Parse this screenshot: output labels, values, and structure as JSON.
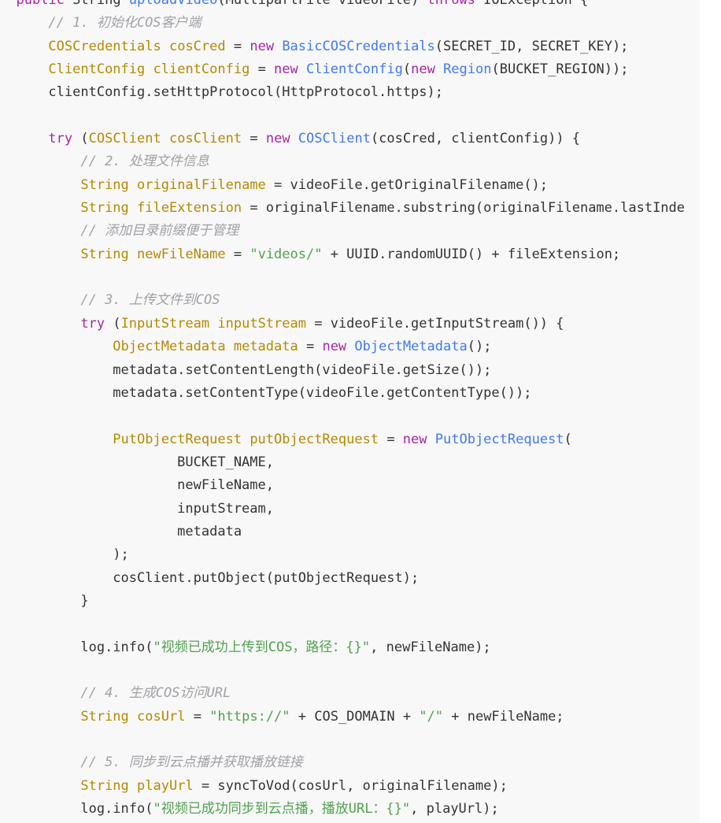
{
  "colors": {
    "background": "#f8f8f8",
    "plain": "#333333",
    "keyword": "#a626a4",
    "type": "#b58900",
    "variable": "#b58900",
    "function": "#4078f2",
    "string": "#50a14f",
    "comment": "#a0a1a7"
  },
  "code": {
    "language": "java",
    "lines": [
      {
        "indent": "  ",
        "tokens": [
          [
            "keyword",
            "public"
          ],
          [
            "plain",
            " String "
          ],
          [
            "func",
            "uploadVideo"
          ],
          [
            "plain",
            "(MultipartFile videoFile) "
          ],
          [
            "keyword",
            "throws"
          ],
          [
            "plain",
            " IOException {"
          ]
        ]
      },
      {
        "indent": "      ",
        "tokens": [
          [
            "comment",
            "// 1. 初始化COS客户端"
          ]
        ]
      },
      {
        "indent": "      ",
        "tokens": [
          [
            "type",
            "COSCredentials"
          ],
          [
            "plain",
            " "
          ],
          [
            "var",
            "cosCred"
          ],
          [
            "plain",
            " = "
          ],
          [
            "keyword",
            "new"
          ],
          [
            "plain",
            " "
          ],
          [
            "func",
            "BasicCOSCredentials"
          ],
          [
            "plain",
            "(SECRET_ID, SECRET_KEY);"
          ]
        ]
      },
      {
        "indent": "      ",
        "tokens": [
          [
            "type",
            "ClientConfig"
          ],
          [
            "plain",
            " "
          ],
          [
            "var",
            "clientConfig"
          ],
          [
            "plain",
            " = "
          ],
          [
            "keyword",
            "new"
          ],
          [
            "plain",
            " "
          ],
          [
            "func",
            "ClientConfig"
          ],
          [
            "plain",
            "("
          ],
          [
            "keyword",
            "new"
          ],
          [
            "plain",
            " "
          ],
          [
            "func",
            "Region"
          ],
          [
            "plain",
            "(BUCKET_REGION));"
          ]
        ]
      },
      {
        "indent": "      ",
        "tokens": [
          [
            "plain",
            "clientConfig.setHttpProtocol(HttpProtocol.https);"
          ]
        ]
      },
      {
        "indent": "",
        "tokens": []
      },
      {
        "indent": "      ",
        "tokens": [
          [
            "keyword",
            "try"
          ],
          [
            "plain",
            " ("
          ],
          [
            "type",
            "COSClient"
          ],
          [
            "plain",
            " "
          ],
          [
            "var",
            "cosClient"
          ],
          [
            "plain",
            " = "
          ],
          [
            "keyword",
            "new"
          ],
          [
            "plain",
            " "
          ],
          [
            "func",
            "COSClient"
          ],
          [
            "plain",
            "(cosCred, clientConfig)) {"
          ]
        ]
      },
      {
        "indent": "          ",
        "tokens": [
          [
            "comment",
            "// 2. 处理文件信息"
          ]
        ]
      },
      {
        "indent": "          ",
        "tokens": [
          [
            "type",
            "String"
          ],
          [
            "plain",
            " "
          ],
          [
            "var",
            "originalFilename"
          ],
          [
            "plain",
            " = videoFile.getOriginalFilename();"
          ]
        ]
      },
      {
        "indent": "          ",
        "tokens": [
          [
            "type",
            "String"
          ],
          [
            "plain",
            " "
          ],
          [
            "var",
            "fileExtension"
          ],
          [
            "plain",
            " = originalFilename.substring(originalFilename.lastInde"
          ]
        ]
      },
      {
        "indent": "          ",
        "tokens": [
          [
            "comment",
            "// 添加目录前缀便于管理"
          ]
        ]
      },
      {
        "indent": "          ",
        "tokens": [
          [
            "type",
            "String"
          ],
          [
            "plain",
            " "
          ],
          [
            "var",
            "newFileName"
          ],
          [
            "plain",
            " = "
          ],
          [
            "string",
            "\"videos/\""
          ],
          [
            "plain",
            " + UUID.randomUUID() + fileExtension;"
          ]
        ]
      },
      {
        "indent": "",
        "tokens": []
      },
      {
        "indent": "          ",
        "tokens": [
          [
            "comment",
            "// 3. 上传文件到COS"
          ]
        ]
      },
      {
        "indent": "          ",
        "tokens": [
          [
            "keyword",
            "try"
          ],
          [
            "plain",
            " ("
          ],
          [
            "type",
            "InputStream"
          ],
          [
            "plain",
            " "
          ],
          [
            "var",
            "inputStream"
          ],
          [
            "plain",
            " = videoFile.getInputStream()) {"
          ]
        ]
      },
      {
        "indent": "              ",
        "tokens": [
          [
            "type",
            "ObjectMetadata"
          ],
          [
            "plain",
            " "
          ],
          [
            "var",
            "metadata"
          ],
          [
            "plain",
            " = "
          ],
          [
            "keyword",
            "new"
          ],
          [
            "plain",
            " "
          ],
          [
            "func",
            "ObjectMetadata"
          ],
          [
            "plain",
            "();"
          ]
        ]
      },
      {
        "indent": "              ",
        "tokens": [
          [
            "plain",
            "metadata.setContentLength(videoFile.getSize());"
          ]
        ]
      },
      {
        "indent": "              ",
        "tokens": [
          [
            "plain",
            "metadata.setContentType(videoFile.getContentType());"
          ]
        ]
      },
      {
        "indent": "",
        "tokens": []
      },
      {
        "indent": "              ",
        "tokens": [
          [
            "type",
            "PutObjectRequest"
          ],
          [
            "plain",
            " "
          ],
          [
            "var",
            "putObjectRequest"
          ],
          [
            "plain",
            " = "
          ],
          [
            "keyword",
            "new"
          ],
          [
            "plain",
            " "
          ],
          [
            "func",
            "PutObjectRequest"
          ],
          [
            "plain",
            "("
          ]
        ]
      },
      {
        "indent": "                      ",
        "tokens": [
          [
            "plain",
            "BUCKET_NAME,"
          ]
        ]
      },
      {
        "indent": "                      ",
        "tokens": [
          [
            "plain",
            "newFileName,"
          ]
        ]
      },
      {
        "indent": "                      ",
        "tokens": [
          [
            "plain",
            "inputStream,"
          ]
        ]
      },
      {
        "indent": "                      ",
        "tokens": [
          [
            "plain",
            "metadata"
          ]
        ]
      },
      {
        "indent": "              ",
        "tokens": [
          [
            "plain",
            ");"
          ]
        ]
      },
      {
        "indent": "              ",
        "tokens": [
          [
            "plain",
            "cosClient.putObject(putObjectRequest);"
          ]
        ]
      },
      {
        "indent": "          ",
        "tokens": [
          [
            "plain",
            "}"
          ]
        ]
      },
      {
        "indent": "",
        "tokens": []
      },
      {
        "indent": "          ",
        "tokens": [
          [
            "plain",
            "log.info("
          ],
          [
            "string",
            "\"视频已成功上传到COS，路径：{}\""
          ],
          [
            "plain",
            ", newFileName);"
          ]
        ]
      },
      {
        "indent": "",
        "tokens": []
      },
      {
        "indent": "          ",
        "tokens": [
          [
            "comment",
            "// 4. 生成COS访问URL"
          ]
        ]
      },
      {
        "indent": "          ",
        "tokens": [
          [
            "type",
            "String"
          ],
          [
            "plain",
            " "
          ],
          [
            "var",
            "cosUrl"
          ],
          [
            "plain",
            " = "
          ],
          [
            "string",
            "\"https://\""
          ],
          [
            "plain",
            " + COS_DOMAIN + "
          ],
          [
            "string",
            "\"/\""
          ],
          [
            "plain",
            " + newFileName;"
          ]
        ]
      },
      {
        "indent": "",
        "tokens": []
      },
      {
        "indent": "          ",
        "tokens": [
          [
            "comment",
            "// 5. 同步到云点播并获取播放链接"
          ]
        ]
      },
      {
        "indent": "          ",
        "tokens": [
          [
            "type",
            "String"
          ],
          [
            "plain",
            " "
          ],
          [
            "var",
            "playUrl"
          ],
          [
            "plain",
            " = syncToVod(cosUrl, originalFilename);"
          ]
        ]
      },
      {
        "indent": "          ",
        "tokens": [
          [
            "plain",
            "log.info("
          ],
          [
            "string",
            "\"视频已成功同步到云点播，播放URL：{}\""
          ],
          [
            "plain",
            ", playUrl);"
          ]
        ]
      }
    ]
  }
}
